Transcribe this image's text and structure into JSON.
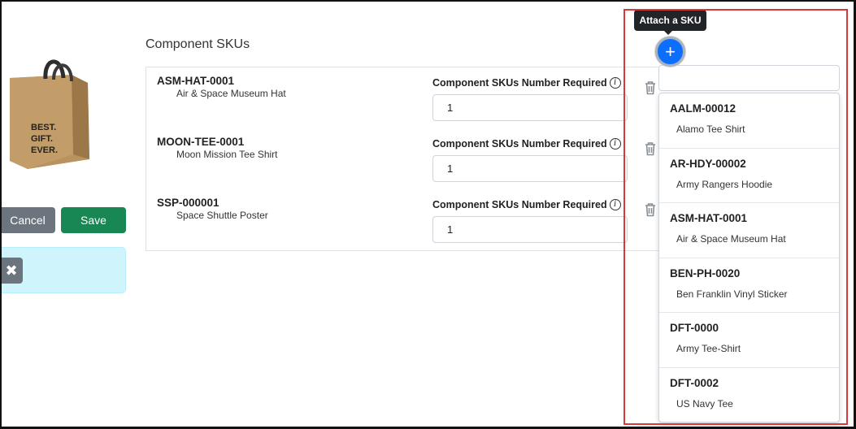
{
  "product": {
    "image_icon": "gift-bag-image",
    "bag_text": [
      "BEST.",
      "GIFT.",
      "EVER."
    ]
  },
  "actions": {
    "cancel_label": "Cancel",
    "save_label": "Save",
    "tools_icon": "tools-icon"
  },
  "section": {
    "title": "Component SKUs"
  },
  "components": [
    {
      "code": "ASM-HAT-0001",
      "name": "Air & Space Museum Hat",
      "qty_label": "Component SKUs Number Required",
      "qty": "1"
    },
    {
      "code": "MOON-TEE-0001",
      "name": "Moon Mission Tee Shirt",
      "qty_label": "Component SKUs Number Required",
      "qty": "1"
    },
    {
      "code": "SSP-000001",
      "name": "Space Shuttle Poster",
      "qty_label": "Component SKUs Number Required",
      "qty": "1"
    }
  ],
  "attach": {
    "tooltip": "Attach a SKU",
    "button_glyph": "+",
    "search_value": "",
    "options": [
      {
        "code": "AALM-00012",
        "name": "Alamo Tee Shirt"
      },
      {
        "code": "AR-HDY-00002",
        "name": "Army Rangers Hoodie"
      },
      {
        "code": "ASM-HAT-0001",
        "name": "Air & Space Museum Hat"
      },
      {
        "code": "BEN-PH-0020",
        "name": "Ben Franklin Vinyl Sticker"
      },
      {
        "code": "DFT-0000",
        "name": "Army Tee-Shirt"
      },
      {
        "code": "DFT-0002",
        "name": "US Navy Tee"
      }
    ]
  },
  "colors": {
    "highlight": "#d9383a",
    "primary": "#0d6efd",
    "success": "#198754",
    "secondary": "#6c757d",
    "info_bg": "#cff4fc"
  }
}
